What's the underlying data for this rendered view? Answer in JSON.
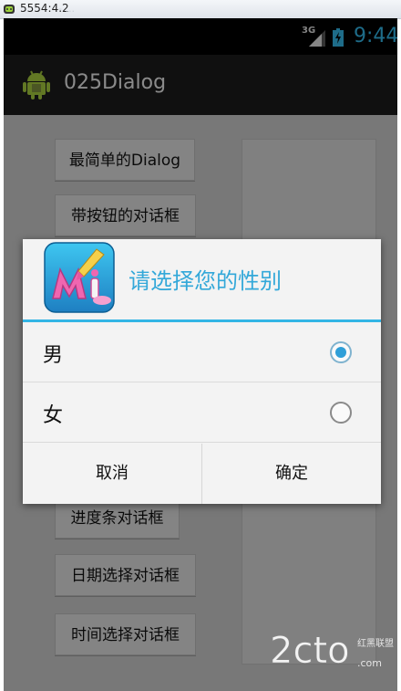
{
  "emulator": {
    "title": "5554:4.2",
    "faded_title": "- ..."
  },
  "status_bar": {
    "network": "3G",
    "time": "9:44",
    "accent": "#33b5e5"
  },
  "action_bar": {
    "app_title": "025Dialog"
  },
  "buttons": [
    "最简单的Dialog",
    "带按钮的对话框",
    "",
    "",
    "",
    "",
    "进度条对话框",
    "日期选择对话框",
    "时间选择对话框"
  ],
  "dialog": {
    "title": "请选择您的性别",
    "options": [
      {
        "label": "男",
        "checked": true
      },
      {
        "label": "女",
        "checked": false
      }
    ],
    "cancel": "取消",
    "confirm": "确定"
  },
  "watermark": {
    "text": "2cto",
    "subtext": "红黑联盟"
  }
}
